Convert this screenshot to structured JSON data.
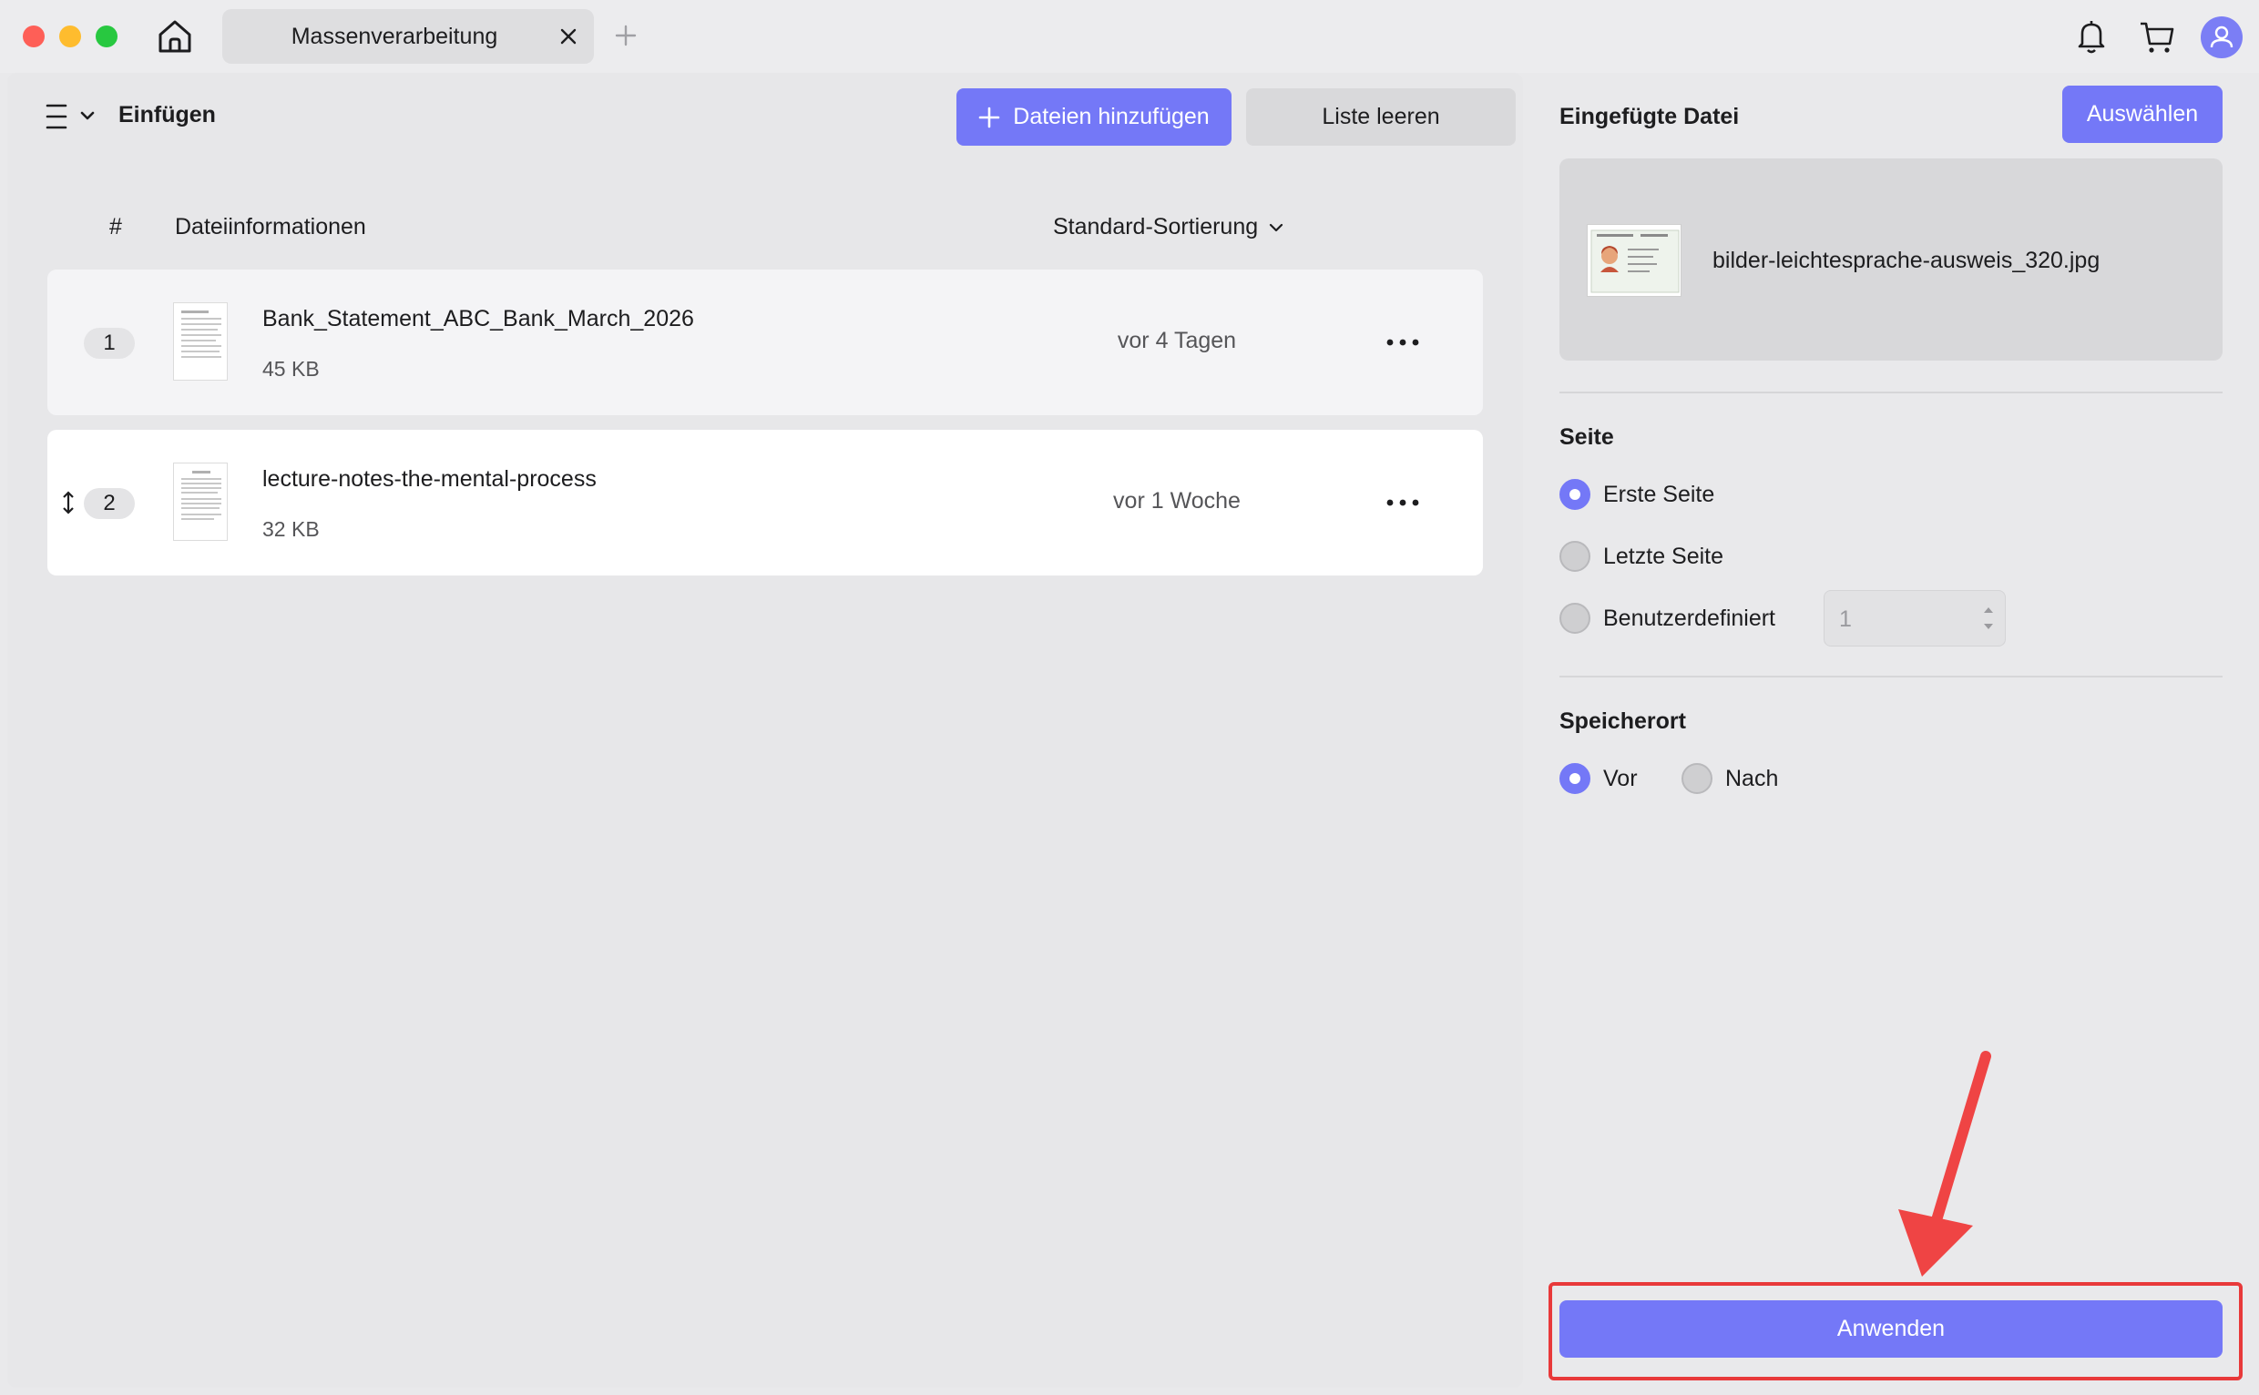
{
  "window": {
    "tab_title": "Massenverarbeitung"
  },
  "toolbar": {
    "mode_label": "Einfügen",
    "add_files_label": "Dateien hinzufügen",
    "clear_list_label": "Liste leeren"
  },
  "file_list": {
    "col_index": "#",
    "col_info": "Dateiinformationen",
    "sort_label": "Standard-Sortierung",
    "rows": [
      {
        "index": "1",
        "name": "Bank_Statement_ABC_Bank_March_2026",
        "size": "45 KB",
        "time": "vor 4 Tagen"
      },
      {
        "index": "2",
        "name": "lecture-notes-the-mental-process",
        "size": "32 KB",
        "time": "vor 1 Woche"
      }
    ]
  },
  "right_panel": {
    "inserted_file_title": "Eingefügte Datei",
    "select_label": "Auswählen",
    "inserted_file_name": "bilder-leichtesprache-ausweis_320.jpg",
    "page_section": {
      "title": "Seite",
      "options": [
        "Erste Seite",
        "Letzte Seite",
        "Benutzerdefiniert"
      ],
      "selected": "Erste Seite",
      "custom_value": "1"
    },
    "location_section": {
      "title": "Speicherort",
      "options": [
        "Vor",
        "Nach"
      ],
      "selected": "Vor"
    },
    "apply_label": "Anwenden"
  },
  "colors": {
    "accent": "#7478f7",
    "annotation_red": "#e8393a"
  }
}
